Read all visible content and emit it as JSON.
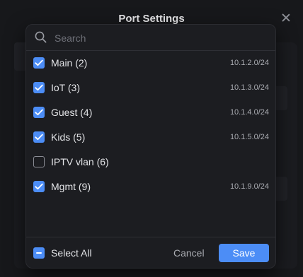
{
  "modal": {
    "title": "Port Settings",
    "close_icon": "close-icon"
  },
  "search": {
    "placeholder": "Search",
    "value": "",
    "icon": "search-icon"
  },
  "networks": [
    {
      "label": "Main (2)",
      "subnet": "10.1.2.0/24",
      "checked": true
    },
    {
      "label": "IoT (3)",
      "subnet": "10.1.3.0/24",
      "checked": true
    },
    {
      "label": "Guest (4)",
      "subnet": "10.1.4.0/24",
      "checked": true
    },
    {
      "label": "Kids (5)",
      "subnet": "10.1.5.0/24",
      "checked": true
    },
    {
      "label": "IPTV vlan (6)",
      "subnet": "",
      "checked": false
    },
    {
      "label": "Mgmt (9)",
      "subnet": "10.1.9.0/24",
      "checked": true
    }
  ],
  "footer": {
    "select_all_label": "Select All",
    "select_all_state": "indeterminate",
    "cancel_label": "Cancel",
    "save_label": "Save"
  },
  "colors": {
    "accent": "#4c8df6",
    "popover_bg": "#1c1d21",
    "text": "#e3e4e7",
    "muted": "#a9abb1"
  }
}
